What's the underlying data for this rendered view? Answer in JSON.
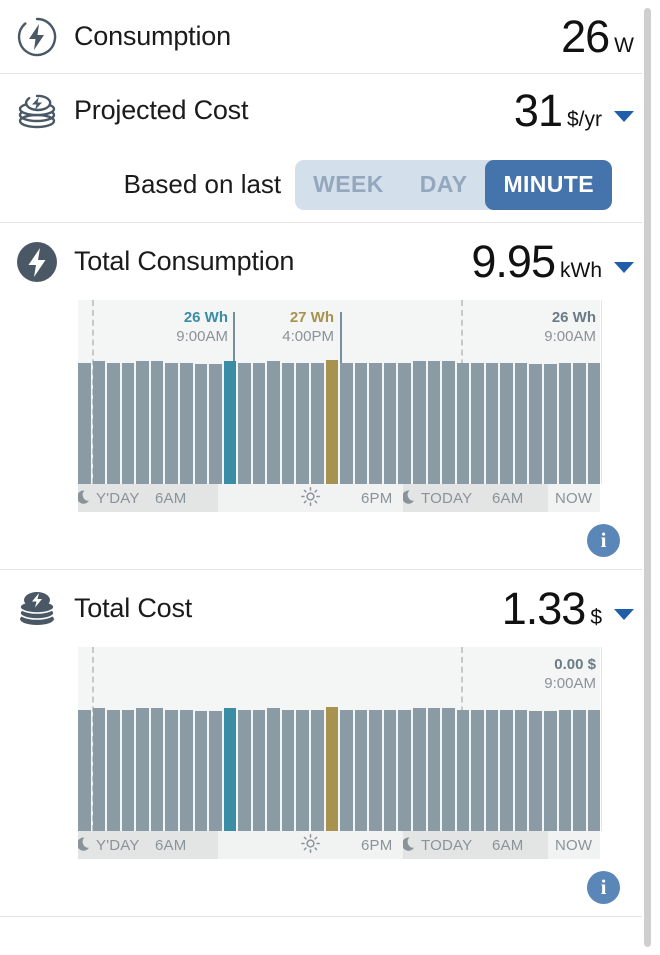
{
  "consumption": {
    "icon": "bolt-circle-outline-icon",
    "title": "Consumption",
    "value": "26",
    "unit": "W"
  },
  "projected_cost": {
    "icon": "coin-stack-bolt-icon",
    "title": "Projected Cost",
    "value": "31",
    "unit": "$/yr",
    "caret": "chevron-down-icon"
  },
  "basis": {
    "label": "Based on last",
    "options": [
      "WEEK",
      "DAY",
      "MINUTE"
    ],
    "selected": "MINUTE"
  },
  "total_consumption": {
    "icon": "bolt-circle-filled-icon",
    "title": "Total Consumption",
    "value": "9.95",
    "unit": "kWh",
    "caret": "chevron-down-icon",
    "info": "i"
  },
  "total_cost": {
    "icon": "coin-stack-bolt-icon",
    "title": "Total Cost",
    "value": "1.33",
    "unit": "$",
    "caret": "chevron-down-icon",
    "info": "i"
  },
  "colors": {
    "bar_default": "#8b9ba6",
    "bar_teal": "#3b8da6",
    "bar_tan": "#a8924f",
    "accent_blue": "#4574ac",
    "caret_blue": "#1f5fa9",
    "info_blue": "#5b87b8",
    "chart_bg": "#f4f5f5",
    "axis_night": "#e3e4e4",
    "axis_day": "#f1f2f2",
    "icon_dark": "#4a5866",
    "seg_bg": "#d4dfec",
    "seg_inactive_text": "#93a7bd"
  },
  "axis": {
    "labels": [
      "Y'DAY",
      "6AM",
      "6PM",
      "TODAY",
      "6AM",
      "NOW"
    ],
    "icons": [
      "moon-icon",
      "sun-icon",
      "moon-icon"
    ]
  },
  "chart_data": [
    {
      "type": "bar",
      "title": "Total Consumption",
      "ylabel": "Wh",
      "xlabel": "",
      "grid": false,
      "legend": "none",
      "categories": [
        "Y'DAY",
        "",
        "",
        "",
        "",
        "",
        "",
        "",
        "",
        "",
        "9:00AM",
        "",
        "",
        "",
        "",
        "",
        "",
        "4:00PM",
        "",
        "",
        "",
        "",
        "",
        "",
        "",
        "TODAY",
        "",
        "",
        "",
        "",
        "",
        "",
        "",
        "",
        "",
        "",
        "",
        "NOW"
      ],
      "values": [
        25,
        26,
        25,
        25,
        26,
        26,
        25,
        25,
        24,
        24,
        26,
        25,
        25,
        26,
        25,
        25,
        25,
        27,
        25,
        25,
        25,
        25,
        25,
        26,
        26,
        26,
        25,
        25,
        25,
        25,
        25,
        24,
        24,
        25,
        25,
        25
      ],
      "highlights": [
        {
          "index": 10,
          "color": "#3b8da6",
          "label": "26 Wh",
          "time": "9:00AM"
        },
        {
          "index": 17,
          "color": "#a8924f",
          "label": "27 Wh",
          "time": "4:00PM"
        },
        {
          "index": 33,
          "color": "#8b9ba6",
          "label": "26 Wh",
          "time": "9:00AM"
        }
      ],
      "annotations": [
        {
          "value": "26 Wh",
          "time": "9:00AM",
          "color": "#3b8da6"
        },
        {
          "value": "27 Wh",
          "time": "4:00PM",
          "color": "#a8924f"
        },
        {
          "value": "26 Wh",
          "time": "9:00AM",
          "color": "#6b7b86"
        }
      ]
    },
    {
      "type": "bar",
      "title": "Total Cost",
      "ylabel": "$",
      "xlabel": "",
      "grid": false,
      "legend": "none",
      "categories": [
        "Y'DAY",
        "",
        "",
        "",
        "",
        "",
        "",
        "",
        "",
        "",
        "9:00AM",
        "",
        "",
        "",
        "",
        "",
        "",
        "4:00PM",
        "",
        "",
        "",
        "",
        "",
        "",
        "",
        "TODAY",
        "",
        "",
        "",
        "",
        "",
        "",
        "",
        "",
        "",
        "",
        "",
        "NOW"
      ],
      "values": [
        25,
        26,
        25,
        25,
        26,
        26,
        25,
        25,
        24,
        24,
        26,
        25,
        25,
        26,
        25,
        25,
        25,
        27,
        25,
        25,
        25,
        25,
        25,
        26,
        26,
        26,
        25,
        25,
        25,
        25,
        25,
        24,
        24,
        25,
        25,
        25
      ],
      "highlights": [
        {
          "index": 10,
          "color": "#3b8da6"
        },
        {
          "index": 17,
          "color": "#a8924f"
        }
      ],
      "annotations": [
        {
          "value": "0.00 $",
          "time": "9:00AM",
          "color": "#6b7b86"
        }
      ]
    }
  ]
}
